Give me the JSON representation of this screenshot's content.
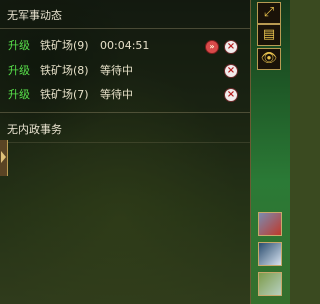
{
  "military": {
    "title": "无军事动态"
  },
  "queue": [
    {
      "tag": "升级",
      "building": "铁矿场(9)",
      "status": "00:04:51",
      "speedup": true
    },
    {
      "tag": "升级",
      "building": "铁矿场(8)",
      "status": "等待中",
      "speedup": false
    },
    {
      "tag": "升级",
      "building": "铁矿场(7)",
      "status": "等待中",
      "speedup": false
    }
  ],
  "domestic": {
    "title": "无内政事务"
  },
  "icons": {
    "speedup": "fast-forward-icon",
    "cancel": "close-icon",
    "expand": "expand-arrow-icon",
    "notice": "scroll-icon",
    "view": "eye-icon"
  },
  "colors": {
    "tag": "#57e04a",
    "text": "#e6e0c8",
    "frame": "#b89a52"
  }
}
